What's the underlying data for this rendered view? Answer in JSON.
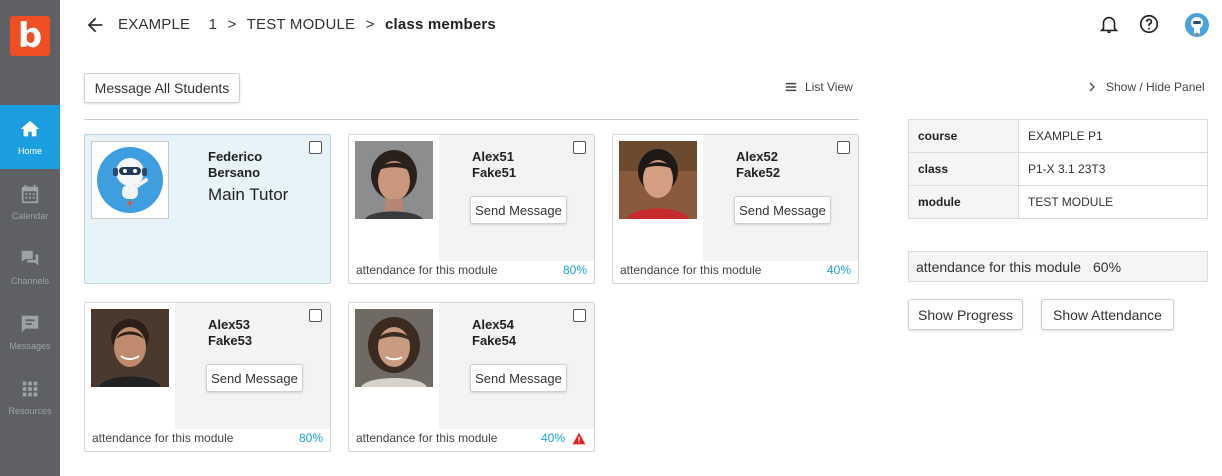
{
  "app": {
    "logo_letter": "b",
    "brand_color": "#f04e23",
    "accent_color": "#1b9ee0"
  },
  "sidebar": {
    "items": [
      {
        "label": "Home",
        "icon": "home-icon",
        "active": true
      },
      {
        "label": "Calendar",
        "icon": "calendar-icon",
        "active": false
      },
      {
        "label": "Channels",
        "icon": "channels-icon",
        "active": false
      },
      {
        "label": "Messages",
        "icon": "messages-icon",
        "active": false
      },
      {
        "label": "Resources",
        "icon": "resources-icon",
        "active": false
      }
    ]
  },
  "header": {
    "breadcrumb": [
      "EXAMPLE",
      "1",
      ">",
      "TEST MODULE",
      ">",
      "class members"
    ],
    "icons": [
      "back-arrow-icon",
      "bell-icon",
      "help-icon",
      "avatar"
    ]
  },
  "toolbar": {
    "message_all_label": "Message All Students",
    "list_view_label": "List View",
    "show_hide_label": "Show / Hide Panel"
  },
  "members": [
    {
      "first": "Federico",
      "last": "Bersano",
      "role": "Main Tutor",
      "is_tutor": true
    },
    {
      "first": "Alex51",
      "last": "Fake51",
      "send_label": "Send Message",
      "attendance_label": "attendance for this module",
      "attendance": "80%",
      "warning": false
    },
    {
      "first": "Alex52",
      "last": "Fake52",
      "send_label": "Send Message",
      "attendance_label": "attendance for this module",
      "attendance": "40%",
      "warning": false
    },
    {
      "first": "Alex53",
      "last": "Fake53",
      "send_label": "Send Message",
      "attendance_label": "attendance for this module",
      "attendance": "80%",
      "warning": false
    },
    {
      "first": "Alex54",
      "last": "Fake54",
      "send_label": "Send Message",
      "attendance_label": "attendance for this module",
      "attendance": "40%",
      "warning": true
    }
  ],
  "panel": {
    "rows": [
      {
        "key": "course",
        "value": "EXAMPLE P1"
      },
      {
        "key": "class",
        "value": "P1-X 3.1 23T3"
      },
      {
        "key": "module",
        "value": "TEST MODULE"
      }
    ],
    "attendance_label": "attendance for this module",
    "attendance_value": "60%",
    "show_progress_label": "Show Progress",
    "show_attendance_label": "Show Attendance"
  }
}
